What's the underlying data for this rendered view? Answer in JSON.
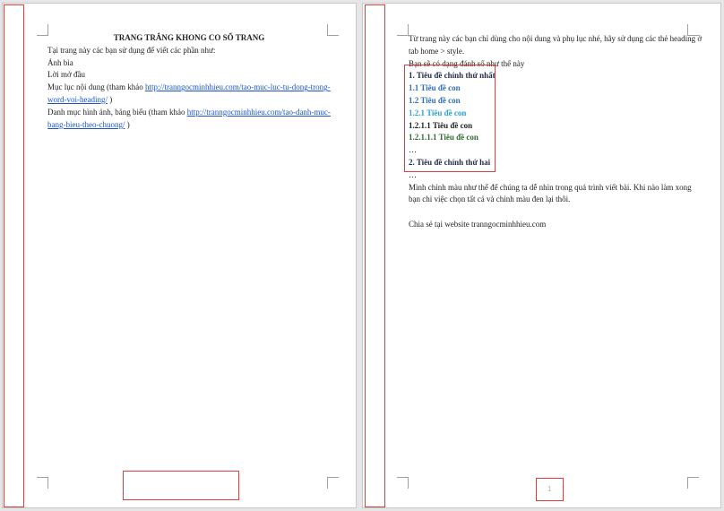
{
  "page1": {
    "title": "TRANG TRẮNG KHONG CO SỐ TRANG",
    "intro": "Tại trang này các bạn sử dụng để viết các phần như:",
    "items": [
      "Ảnh bìa",
      "Lời mở đầu"
    ],
    "toc_prefix": "Mục lục nội dung (tham khảo ",
    "toc_link_1": "http://tranngocminhhieu.com/tao-muc-luc-tu-dong-trong-",
    "toc_link_2": "word-voi-heading/",
    "toc_suffix": " )",
    "fig_prefix": "Danh mục hình ảnh, bảng biểu (tham khảo ",
    "fig_link_1": "http://tranngocminhhieu.com/tao-danh-muc-",
    "fig_link_2": "bang-bieu-theo-chuong/",
    "fig_suffix": " )"
  },
  "page2": {
    "line1": "Từ trang này các bạn chỉ dùng cho nội dung và phụ lục nhé, hãy sử dụng các thẻ heading ở",
    "line2": "tab home > style.",
    "line3": "Bạn sẽ có dạng đánh số như thế này",
    "headings": {
      "h1": "1. Tiêu đề chính thứ nhất",
      "h2a": "1.1 Tiêu đề con",
      "h2b": "1.2 Tiêu đề con",
      "h3": "1.2.1 Tiêu đề con",
      "h4": "1.2.1.1 Tiêu đề con",
      "h5": "1.2.1.1.1 Tiêu đề con",
      "ellipsis": "…",
      "h1b": "2. Tiêu đề chính thứ hai"
    },
    "after_ellipsis": "…",
    "note1": "Mình chỉnh màu như thế để chúng ta dễ nhìn trong quá trình viết bài. Khi nào làm xong",
    "note2": "bạn chỉ việc chọn tất cả và chỉnh màu đen lại thôi.",
    "share": "Chia sẻ tại website tranngocminhhieu.com",
    "page_number": "1"
  }
}
